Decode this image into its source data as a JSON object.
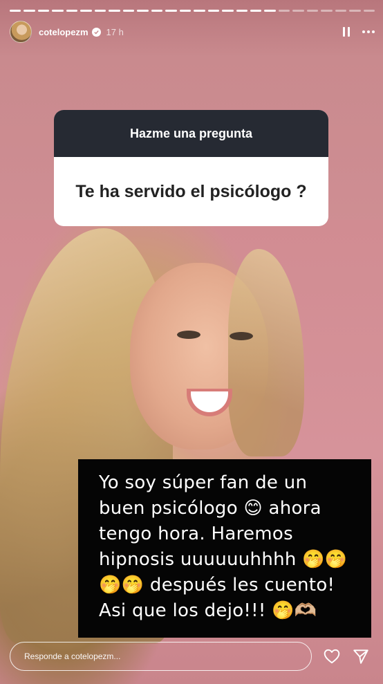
{
  "story": {
    "progress": {
      "segments_total": 26,
      "segments_done": 19
    },
    "header": {
      "username": "cotelopezm",
      "verified": true,
      "time": "17 h"
    },
    "question_sticker": {
      "title": "Hazme una pregunta",
      "question": "Te ha servido el psicólogo ?"
    },
    "caption": {
      "text": "Yo soy súper fan de un\nbuen psicólogo 😊 ahora\ntengo hora. Haremos\nhipnosis uuuuuuhhhh 🤭🤭\n🤭🤭 después les cuento!\nAsi que los dejo!!! 🤭🫶🏼"
    },
    "reply": {
      "placeholder": "Responde a cotelopezm..."
    },
    "icons": [
      "pause-icon",
      "more-icon",
      "verified-icon",
      "heart-icon",
      "send-icon"
    ],
    "colors": {
      "sticker_header": "#262a33",
      "background": "#c98a8e"
    }
  }
}
